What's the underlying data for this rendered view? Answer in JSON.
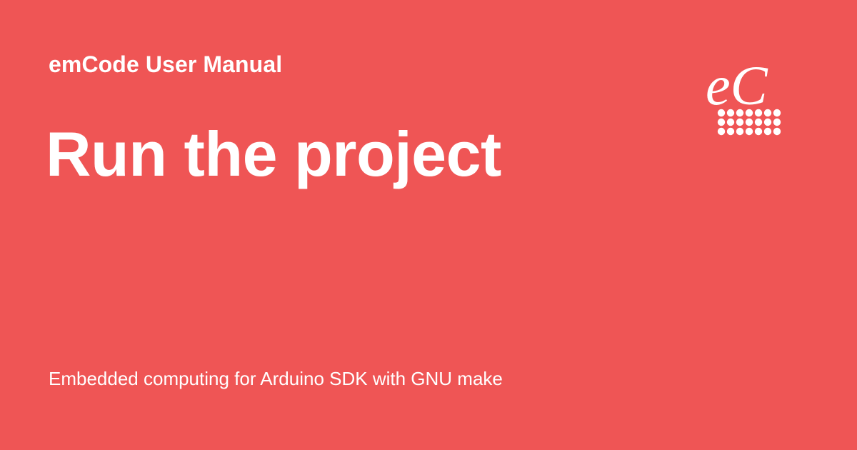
{
  "header": {
    "kicker": "emCode User Manual"
  },
  "main": {
    "title": "Run the project",
    "subtitle": "Embedded computing for Arduino SDK with GNU make"
  },
  "logo": {
    "text": "eC",
    "icon": "emcode-logo-icon",
    "dots_icon": "dot-grid-icon"
  },
  "colors": {
    "background": "#ef5555",
    "foreground": "#ffffff"
  }
}
